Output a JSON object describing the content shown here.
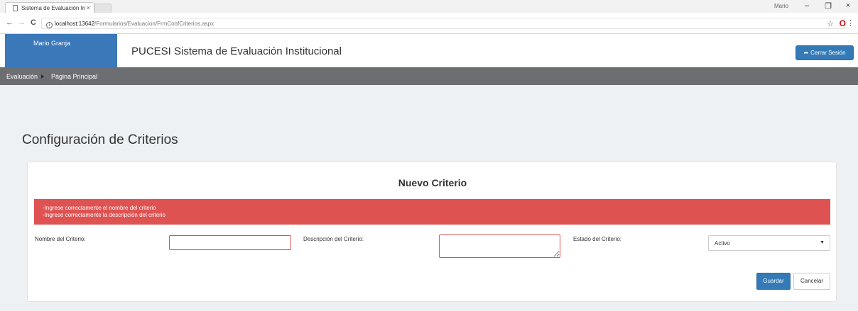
{
  "browser": {
    "tab_title": "Sistema de Evaluación In",
    "tab_close": "×",
    "user_label": "Mario",
    "url_host": "localhost:13642",
    "url_path": "/Formularios/Evaluacion/FrmConfCriterios.aspx",
    "back": "←",
    "forward": "→",
    "reload": "C",
    "info": "i",
    "star": "☆",
    "opera": "O",
    "menu": "⋮",
    "minimize": "–",
    "restore": "❐",
    "close": "×"
  },
  "header": {
    "user_name": "Mario Granja",
    "app_title": "PUCESI Sistema de Evaluación Institucional",
    "logout_icon": "➦",
    "logout_label": "Cerrar Sesión"
  },
  "nav": {
    "items": [
      {
        "label": "Evaluación"
      },
      {
        "label": "Página Principal"
      }
    ]
  },
  "main": {
    "page_title": "Configuración de Criterios",
    "panel_title": "Nuevo Criterio",
    "errors": [
      "-Ingrese correctamente el nombre del criterio",
      "-Ingrese correctamente la descripción del criterio"
    ],
    "form": {
      "name_label": "Nombre del Criterio:",
      "name_value": "",
      "description_label": "Descripción del Criterio:",
      "description_value": "",
      "status_label": "Estado del Criterio:",
      "status_selected": "Activo"
    },
    "buttons": {
      "save": "Guardar",
      "cancel": "Cancelar"
    }
  },
  "colors": {
    "brand_blue": "#337ab7",
    "user_box": "#3a78b9",
    "navbar": "#6d6e71",
    "alert": "#de5252",
    "page_bg": "#eef1f3"
  }
}
